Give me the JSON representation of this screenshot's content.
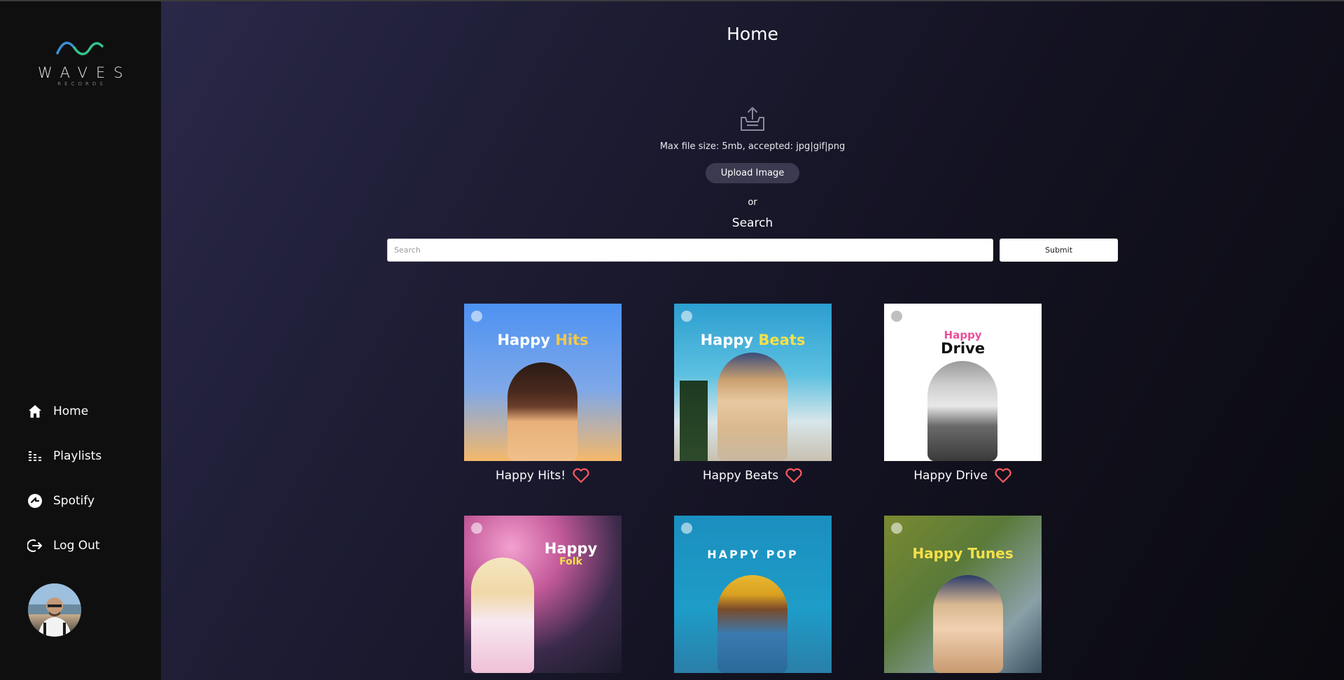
{
  "brand": {
    "name": "WAVES",
    "sub": "RECORDS"
  },
  "sidebar": {
    "items": [
      {
        "label": "Home",
        "icon": "home-icon"
      },
      {
        "label": "Playlists",
        "icon": "equalizer-icon"
      },
      {
        "label": "Spotify",
        "icon": "spotify-icon"
      },
      {
        "label": "Log Out",
        "icon": "logout-icon"
      }
    ]
  },
  "main": {
    "title": "Home",
    "upload": {
      "hint": "Max file size: 5mb, accepted: jpg|gif|png",
      "button": "Upload Image"
    },
    "or": "or",
    "search": {
      "heading": "Search",
      "placeholder": "Search",
      "value": "",
      "submit": "Submit"
    },
    "playlists": [
      {
        "name": "Happy Hits!",
        "cover_line1": "Happy",
        "cover_line2": "Hits",
        "accent": "#f2c94c",
        "bg": "#5a9cf0"
      },
      {
        "name": "Happy Beats",
        "cover_line1": "Happy",
        "cover_line2": "Beats",
        "accent": "#f5e04a",
        "bg": "#3aa6c9"
      },
      {
        "name": "Happy Drive",
        "cover_line1": "Happy",
        "cover_line2": "Drive",
        "accent": "#e84f9a",
        "bg": "#ffffff"
      },
      {
        "name": "",
        "cover_line1": "Happy",
        "cover_line2": "Folk",
        "accent": "#f5e04a",
        "bg": "#c45a9a"
      },
      {
        "name": "",
        "cover_line1": "HAPPY POP",
        "cover_line2": "",
        "accent": "#ffffff",
        "bg": "#1792b8"
      },
      {
        "name": "",
        "cover_line1": "Happy Tunes",
        "cover_line2": "",
        "accent": "#f5e04a",
        "bg": "#6c8a3a"
      }
    ]
  },
  "colors": {
    "heart": "#ff5a5f",
    "logo_wave_blue": "#3b8fd6",
    "logo_wave_green": "#36c28a"
  }
}
